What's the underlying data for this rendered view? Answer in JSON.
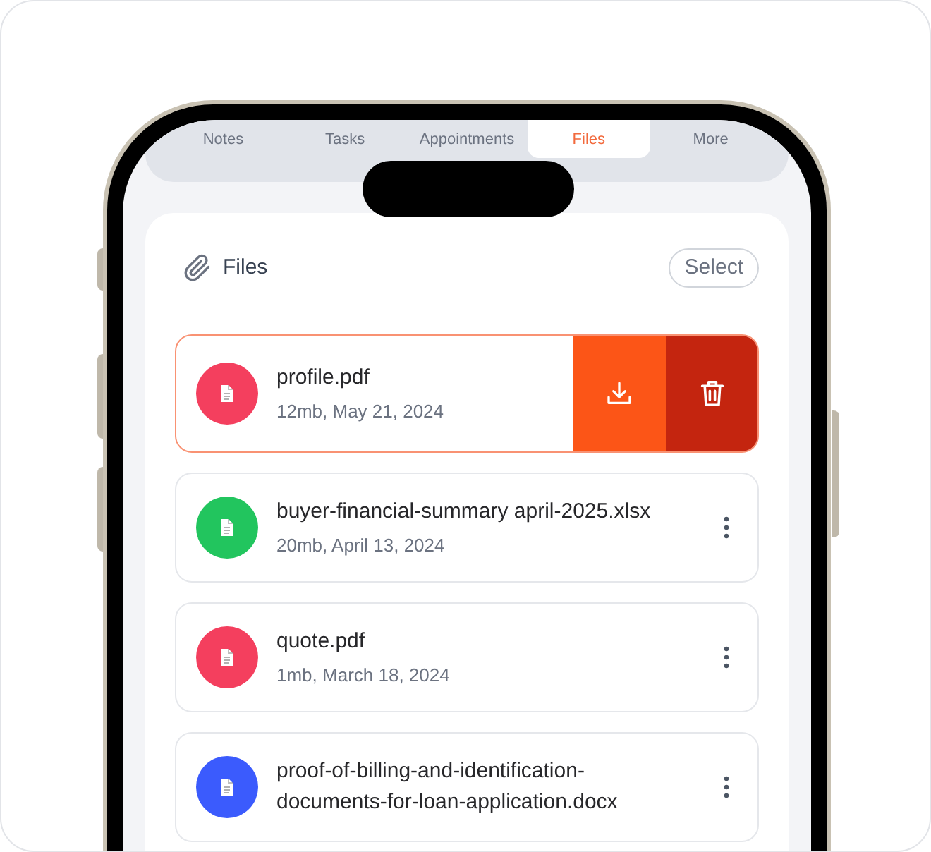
{
  "tabs": [
    {
      "label": "Notes",
      "selected": false
    },
    {
      "label": "Tasks",
      "selected": false
    },
    {
      "label": "Appointments",
      "selected": false
    },
    {
      "label": "Files",
      "selected": true
    },
    {
      "label": "More",
      "selected": false
    }
  ],
  "files_panel": {
    "title": "Files",
    "select_button": "Select"
  },
  "files": [
    {
      "name": "profile.pdf",
      "meta": "12mb, May 21, 2024",
      "color": "#f43f5e",
      "swiped": true
    },
    {
      "name": "buyer-financial-summary april-2025.xlsx",
      "meta": "20mb, April 13, 2024",
      "color": "#22c55e",
      "swiped": false
    },
    {
      "name": "quote.pdf",
      "meta": "1mb, March 18, 2024",
      "color": "#f43f5e",
      "swiped": false
    },
    {
      "name": "proof-of-billing-and-identification-documents-for-loan-application.docx",
      "color": "#3b5bfd",
      "swiped": false
    }
  ]
}
